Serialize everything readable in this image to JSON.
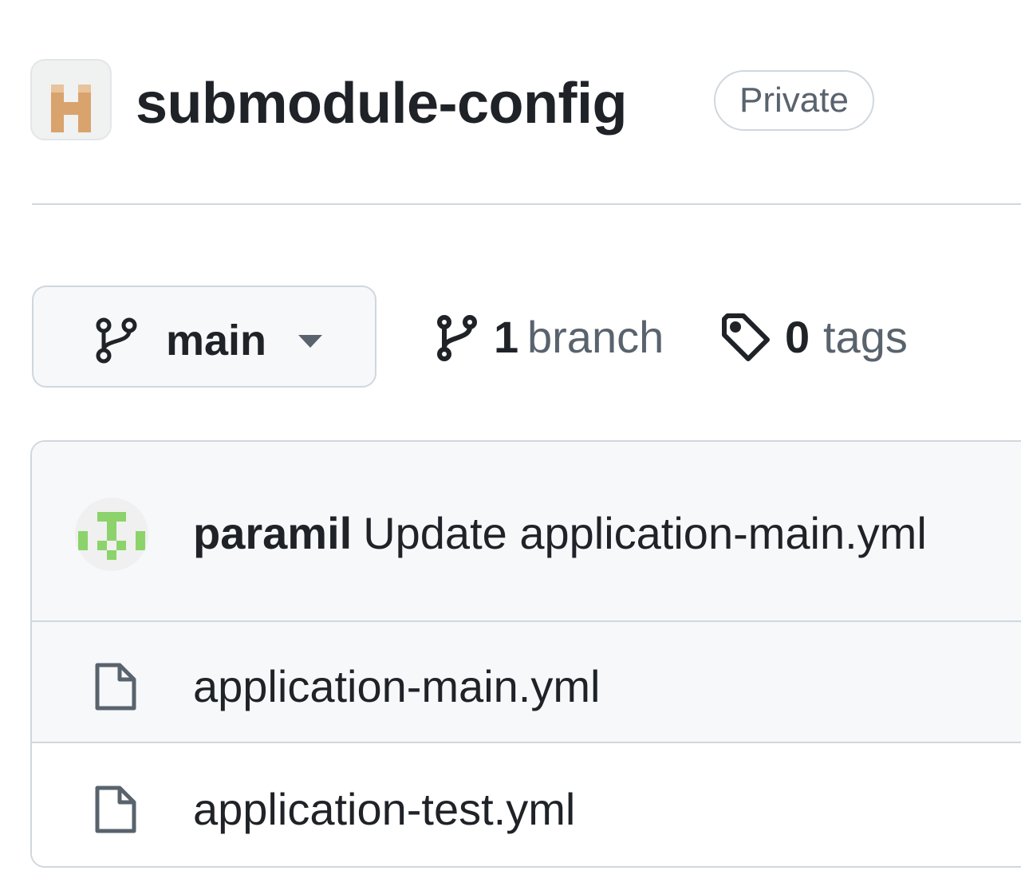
{
  "repo": {
    "avatar_icon": "identicon-avatar",
    "avatar_color": "#d9a36e",
    "name": "submodule-config",
    "visibility": "Private"
  },
  "branch_selector": {
    "icon": "git-branch-icon",
    "current_branch": "main",
    "caret_icon": "triangle-down-icon"
  },
  "branches": {
    "icon": "git-branch-icon",
    "count": "1",
    "label": "branch"
  },
  "tags": {
    "icon": "tag-icon",
    "count": "0",
    "label": "tags"
  },
  "latest_commit": {
    "avatar_icon": "identicon-avatar",
    "avatar_color": "#8bd36a",
    "author": "paramil",
    "message": "Update application-main.yml"
  },
  "files": [
    {
      "name": "application-main.yml",
      "icon": "file-icon"
    },
    {
      "name": "application-test.yml",
      "icon": "file-icon"
    }
  ],
  "colors": {
    "text": "#1f2328",
    "muted": "#59636e",
    "border": "#d0d7de",
    "subtle_bg": "#f6f8fa"
  }
}
